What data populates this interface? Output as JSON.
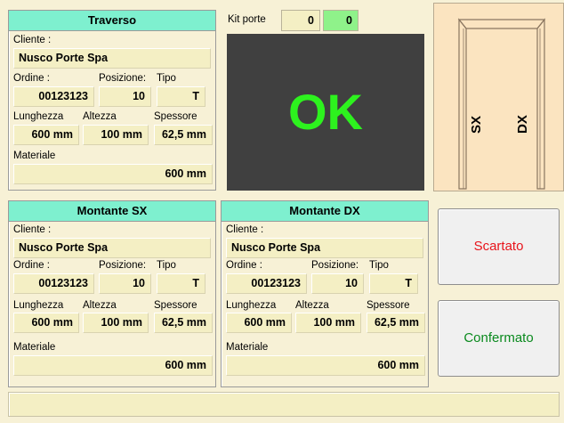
{
  "traverso": {
    "title": "Traverso",
    "cliente_label": "Cliente :",
    "cliente": "Nusco Porte Spa",
    "ordine_label": "Ordine :",
    "ordine": "00123123",
    "posizione_label": "Posizione:",
    "posizione": "10",
    "tipo_label": "Tipo",
    "tipo": "T",
    "lunghezza_label": "Lunghezza",
    "lunghezza": "600 mm",
    "altezza_label": "Altezza",
    "altezza": "100 mm",
    "spessore_label": "Spessore",
    "spessore": "62,5 mm",
    "materiale_label": "Materiale",
    "materiale": "600 mm"
  },
  "kit": {
    "label": "Kit  porte",
    "value_a": "0",
    "value_b": "0",
    "status": "OK",
    "status_color": "#2df21e"
  },
  "door_diagram": {
    "left_label": "SX",
    "right_label": "DX"
  },
  "montante_sx": {
    "title": "Montante SX",
    "cliente_label": "Cliente :",
    "cliente": "Nusco Porte Spa",
    "ordine_label": "Ordine :",
    "ordine": "00123123",
    "posizione_label": "Posizione:",
    "posizione": "10",
    "tipo_label": "Tipo",
    "tipo": "T",
    "lunghezza_label": "Lunghezza",
    "lunghezza": "600 mm",
    "altezza_label": "Altezza",
    "altezza": "100 mm",
    "spessore_label": "Spessore",
    "spessore": "62,5 mm",
    "materiale_label": "Materiale",
    "materiale": "600 mm"
  },
  "montante_dx": {
    "title": "Montante DX",
    "cliente_label": "Cliente :",
    "cliente": "Nusco Porte Spa",
    "ordine_label": "Ordine :",
    "ordine": "00123123",
    "posizione_label": "Posizione:",
    "posizione": "10",
    "tipo_label": "Tipo",
    "tipo": "T",
    "lunghezza_label": "Lunghezza",
    "lunghezza": "600 mm",
    "altezza_label": "Altezza",
    "altezza": "100 mm",
    "spessore_label": "Spessore",
    "spessore": "62,5 mm",
    "materiale_label": "Materiale",
    "materiale": "600 mm"
  },
  "buttons": {
    "scartato": "Scartato",
    "scartato_color": "#e8141b",
    "confermato": "Confermato",
    "confermato_color": "#0a8a1e"
  },
  "colors": {
    "panel_header": "#7ef0cf",
    "background": "#f7f1d6",
    "field": "#f4efc4",
    "kit_green": "#8ff28a",
    "ok_bg": "#404040"
  }
}
